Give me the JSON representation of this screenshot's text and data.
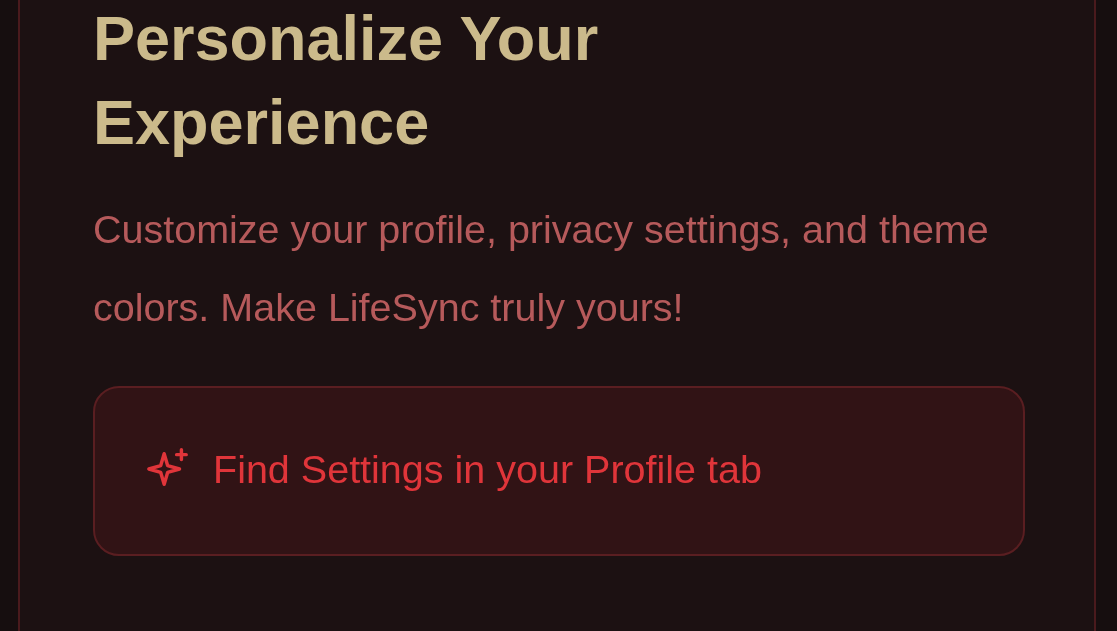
{
  "card": {
    "title": "Personalize Your Experience",
    "description": "Customize your profile, privacy settings, and theme colors. Make LifeSync truly yours!",
    "hint": {
      "label": "Find Settings in your Profile tab"
    }
  }
}
